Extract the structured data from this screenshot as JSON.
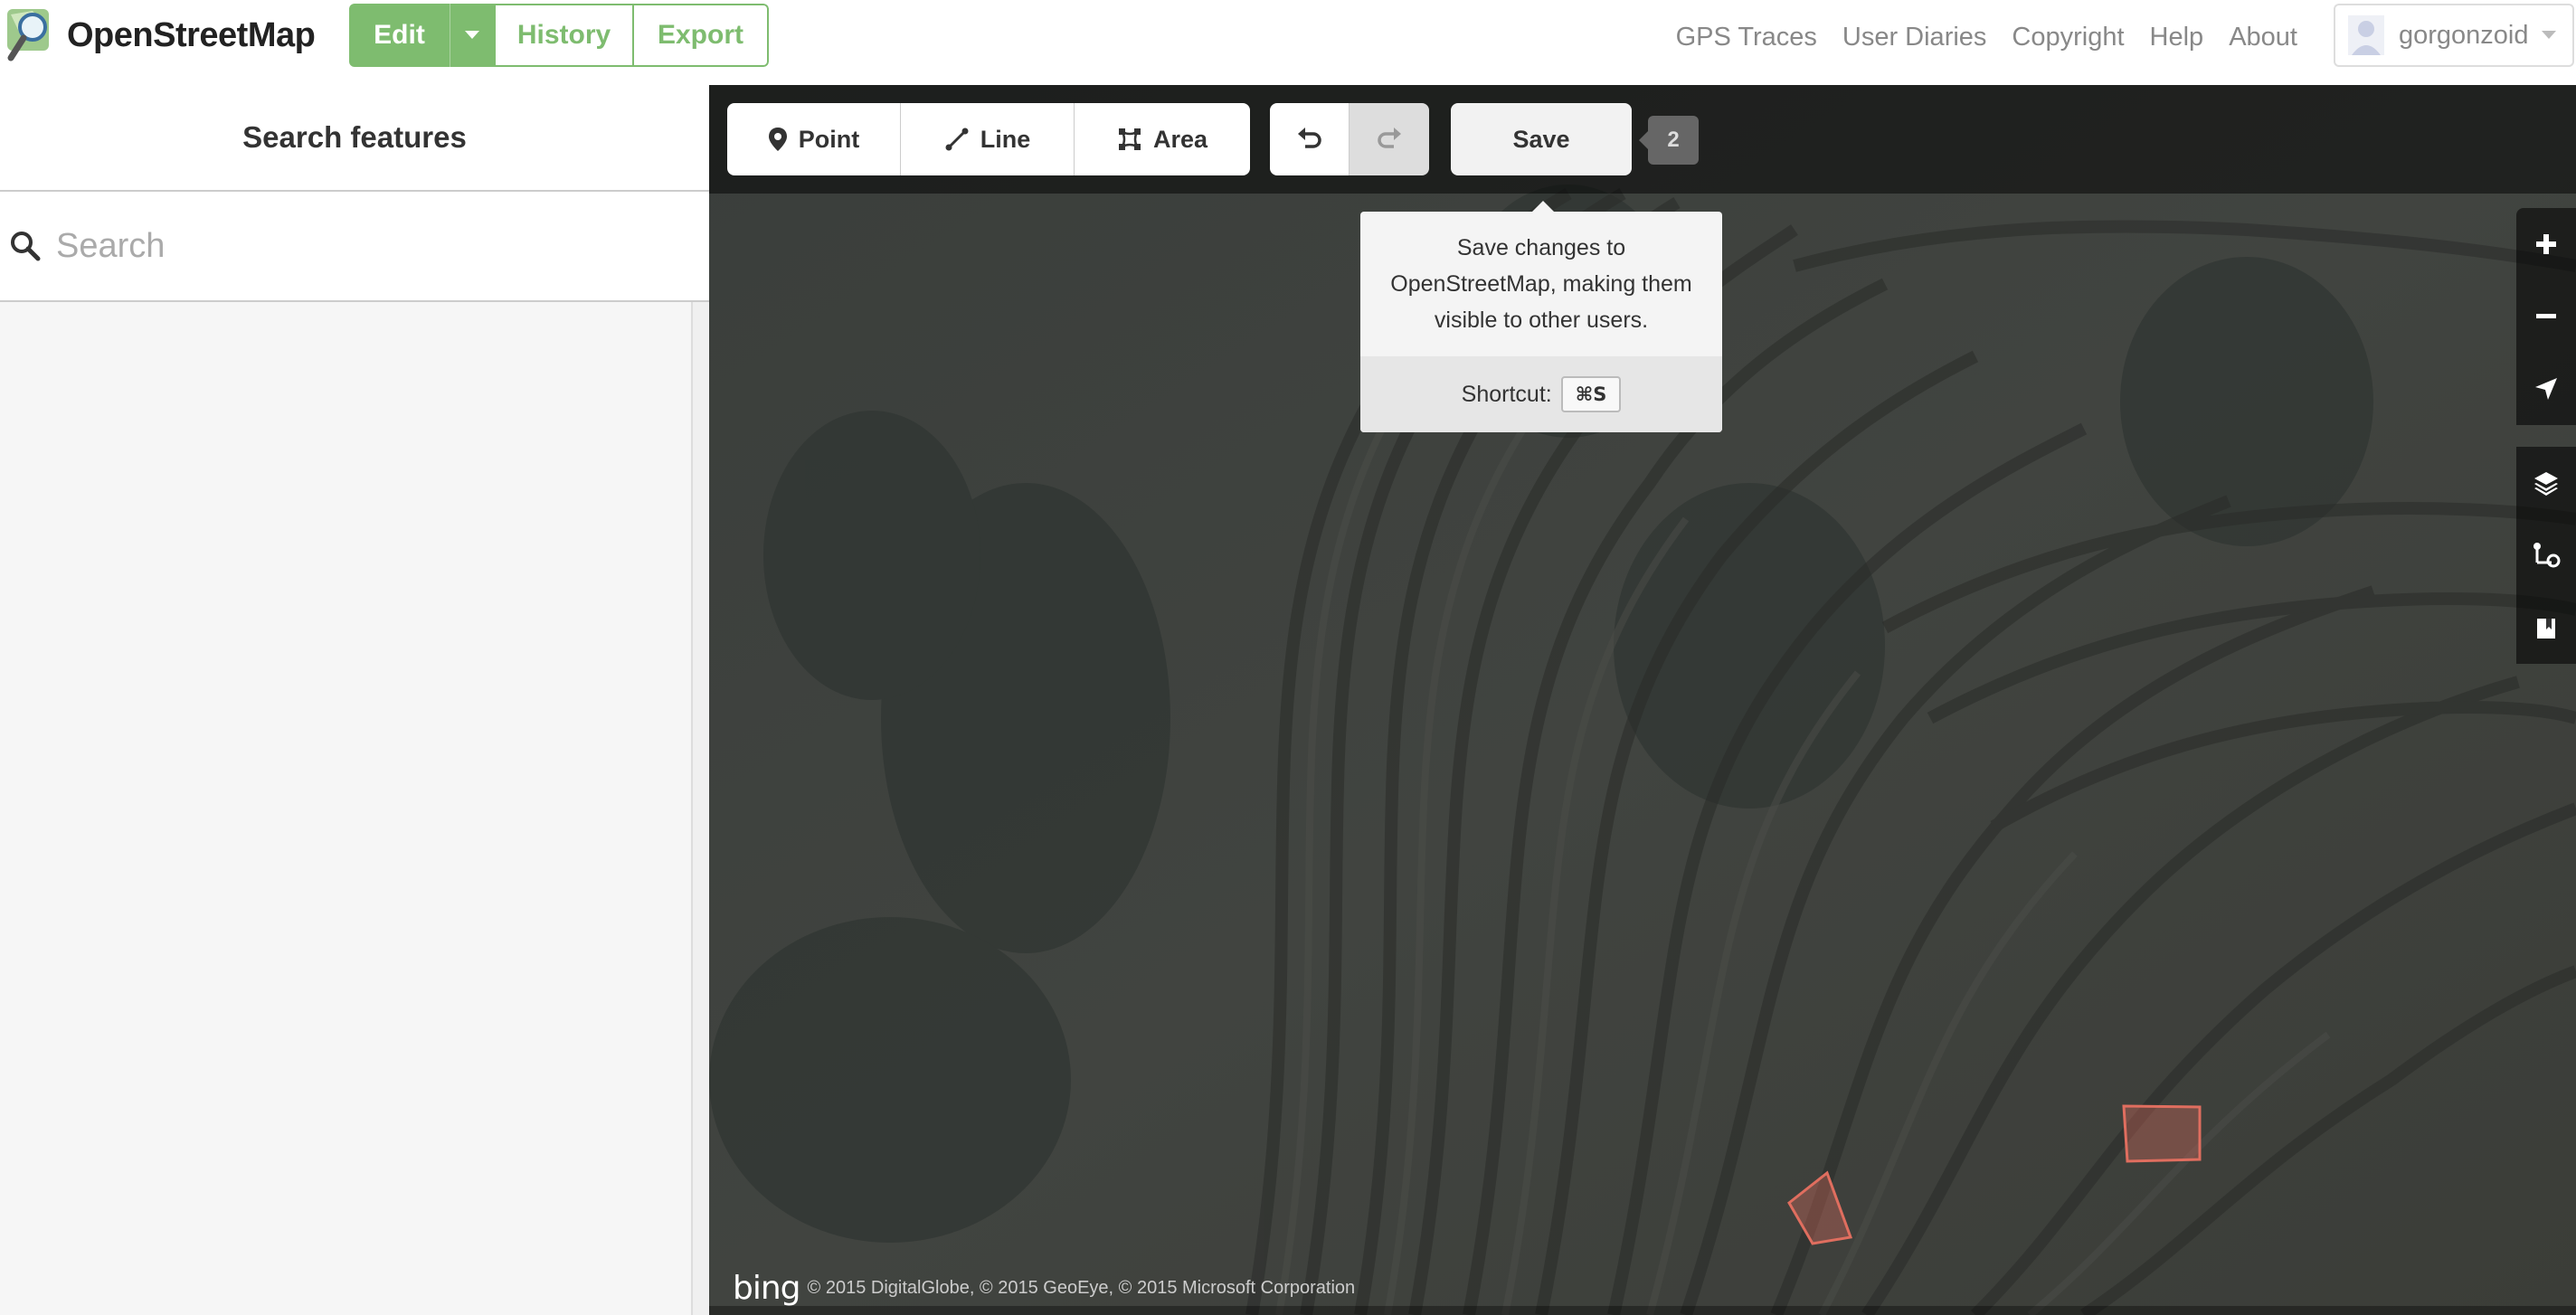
{
  "header": {
    "brand": "OpenStreetMap",
    "edit_label": "Edit",
    "history_label": "History",
    "export_label": "Export",
    "nav": [
      "GPS Traces",
      "User Diaries",
      "Copyright",
      "Help",
      "About"
    ],
    "username": "gorgonzoid"
  },
  "sidebar": {
    "title": "Search features",
    "search_placeholder": "Search"
  },
  "toolbar": {
    "point_label": "Point",
    "line_label": "Line",
    "area_label": "Area",
    "save_label": "Save",
    "change_count": "2"
  },
  "tooltip": {
    "text": "Save changes to OpenStreetMap, making them visible to other users.",
    "shortcut_label": "Shortcut:",
    "shortcut_key": "⌘S"
  },
  "attribution": {
    "logo": "bing",
    "text": "© 2015 DigitalGlobe, © 2015 GeoEye, © 2015 Microsoft Corporation"
  },
  "colors": {
    "brand_green": "#7ebc6f",
    "area_outline": "#e06e5f"
  },
  "icons": [
    "magnifier-logo-icon",
    "caret-down-icon",
    "user-avatar-icon",
    "search-icon",
    "point-icon",
    "line-icon",
    "area-icon",
    "undo-icon",
    "redo-icon",
    "zoom-in-icon",
    "zoom-out-icon",
    "geolocate-icon",
    "layers-icon",
    "map-data-icon",
    "help-icon"
  ]
}
